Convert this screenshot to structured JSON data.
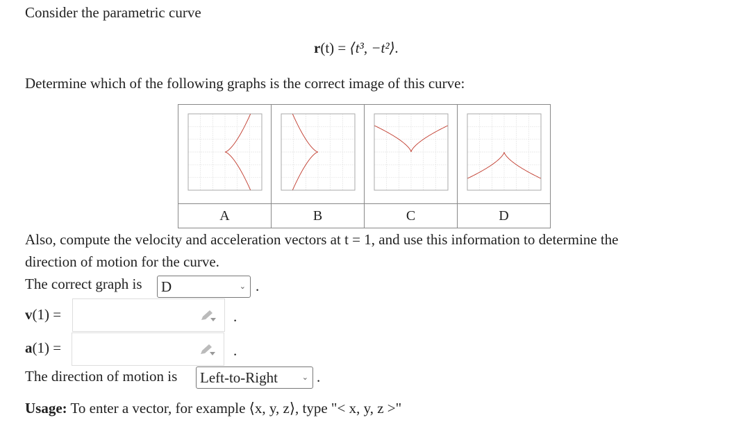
{
  "intro": "Consider the parametric curve",
  "equation": {
    "lhs": "r",
    "arg": "(t) = ",
    "body": "⟨t³, −t²⟩."
  },
  "question": "Determine which of the following graphs is the correct image of this curve:",
  "graphs": [
    {
      "label": "A",
      "curve": "cusp-left-opening-right"
    },
    {
      "label": "B",
      "curve": "cusp-right-opening-left"
    },
    {
      "label": "C",
      "curve": "cusp-bottom-opening-up"
    },
    {
      "label": "D",
      "curve": "cusp-top-opening-down"
    }
  ],
  "curve_color": "#c0392b",
  "also_line1": "Also, compute the velocity and acceleration vectors at t = 1, and use this information to determine the",
  "also_line2": "direction of motion for the curve.",
  "graph_prompt": "The correct graph is",
  "graph_selected": "D",
  "v_label": "v",
  "v_rest": "(1) =",
  "v_value": "",
  "a_label": "a",
  "a_rest": "(1) =",
  "a_value": "",
  "direction_prompt": "The direction of motion is",
  "direction_selected": "Left-to-Right",
  "period": ".",
  "usage_bold": "Usage:",
  "usage_text": "To enter a vector, for example ⟨x, y, z⟩, type \"< x, y, z >\""
}
